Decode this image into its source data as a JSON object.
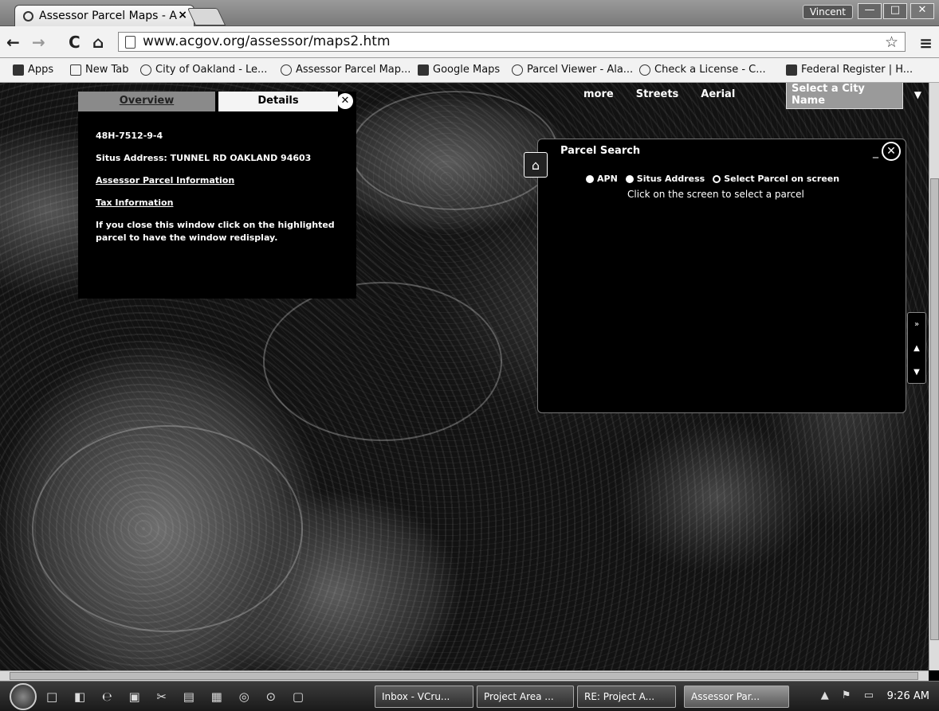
{
  "browser": {
    "tab_title": "Assessor Parcel Maps - A",
    "tab_close": "×",
    "user": "Vincent",
    "win_min": "—",
    "win_max": "□",
    "win_close": "✕",
    "url": "www.acgov.org/assessor/maps2.htm",
    "back": "←",
    "forward": "→",
    "reload": "C",
    "home": "⌂",
    "star": "☆",
    "menu": "≡"
  },
  "bookmarks": [
    {
      "label": "Apps",
      "icon": "apps-grid-icon"
    },
    {
      "label": "New Tab",
      "icon": "page-icon"
    },
    {
      "label": "City of Oakland - Le...",
      "icon": "oakland-logo-icon"
    },
    {
      "label": "Assessor Parcel Map...",
      "icon": "acgov-icon"
    },
    {
      "label": "Google Maps",
      "icon": "maps-icon"
    },
    {
      "label": "Parcel Viewer - Ala...",
      "icon": "acgov-icon"
    },
    {
      "label": "Check a License - C...",
      "icon": "license-icon"
    },
    {
      "label": "Federal Register | H...",
      "icon": "federal-register-icon"
    }
  ],
  "map": {
    "links": [
      "more",
      "Streets",
      "Aerial"
    ],
    "city_select": "Select a City Name"
  },
  "details": {
    "tab_overview": "Overview",
    "tab_details": "Details",
    "close": "✕",
    "apn": "48H-7512-9-4",
    "situs": "Situs Address: TUNNEL RD OAKLAND 94603",
    "assessor_link": "Assessor Parcel Information",
    "tax_link": "Tax Information",
    "note": "If you close this window click on the highlighted parcel to have the window redisplay."
  },
  "parcel_search": {
    "title": "Parcel Search",
    "minimize": "_",
    "close": "✕",
    "options": [
      "APN",
      "Situs Address",
      "Select Parcel on screen"
    ],
    "selected_option": "Select Parcel on screen",
    "hint": "Click on the screen to select a parcel"
  },
  "side_controls": [
    "»",
    "▲",
    "▼"
  ],
  "taskbar": {
    "tasks": [
      {
        "label": "Inbox - VCru..."
      },
      {
        "label": "Project Area ..."
      },
      {
        "label": "RE: Project A..."
      },
      {
        "label": "Assessor Par..."
      }
    ],
    "clock": "9:26 AM"
  }
}
